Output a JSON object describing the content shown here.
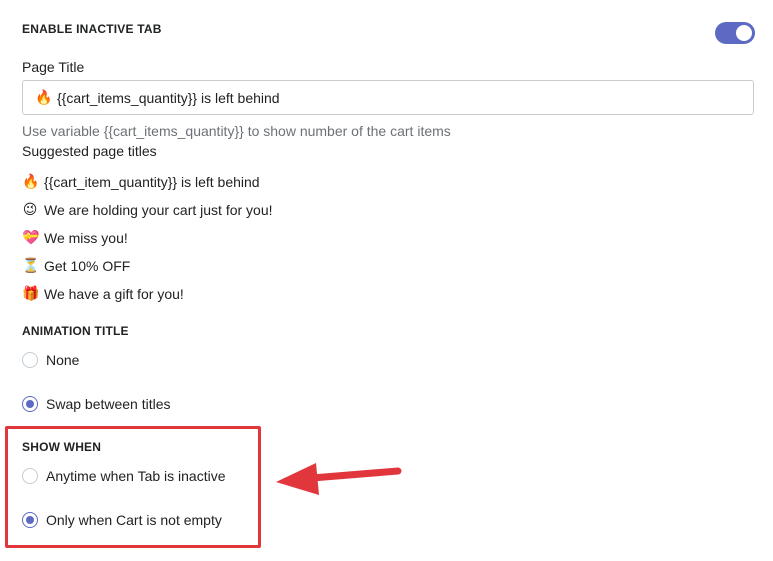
{
  "inactive_tab": {
    "heading": "ENABLE INACTIVE TAB",
    "enabled": true
  },
  "page_title": {
    "label": "Page Title",
    "value": "{{cart_items_quantity}} is left behind",
    "value_icon": "fire-icon",
    "help": "Use variable {{cart_items_quantity}} to show number of the cart items"
  },
  "suggested": {
    "heading": "Suggested page titles",
    "items": [
      {
        "icon": "fire-icon",
        "glyph": "🔥",
        "label": "{{cart_item_quantity}} is left behind"
      },
      {
        "icon": "wink-face-icon",
        "glyph": "😉",
        "label": "We are holding your cart just for you!"
      },
      {
        "icon": "heart-icon",
        "glyph": "💝",
        "label": "We miss you!"
      },
      {
        "icon": "hourglass-icon",
        "glyph": "⏳",
        "label": "Get 10% OFF"
      },
      {
        "icon": "gift-icon",
        "glyph": "🎁",
        "label": "We have a gift for you!"
      }
    ]
  },
  "animation_title": {
    "heading": "ANIMATION TITLE",
    "options": [
      {
        "label": "None",
        "checked": false
      },
      {
        "label": "Swap between titles",
        "checked": true
      }
    ]
  },
  "show_when": {
    "heading": "SHOW WHEN",
    "options": [
      {
        "label": "Anytime when Tab is inactive",
        "checked": false
      },
      {
        "label": "Only when Cart is not empty",
        "checked": true
      }
    ]
  },
  "colors": {
    "accent": "#5c6ac4",
    "annotation_red": "#e0363c"
  }
}
